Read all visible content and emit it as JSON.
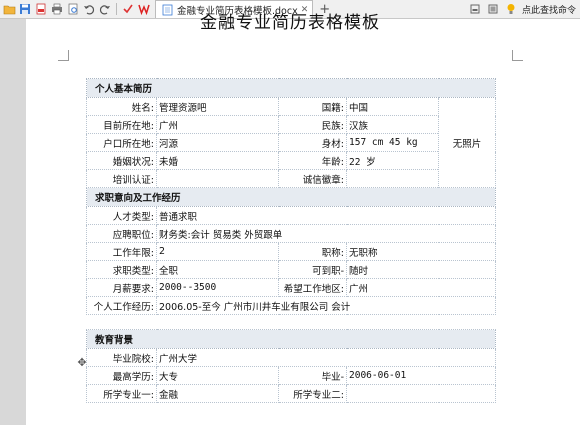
{
  "toolbar": {
    "icons": [
      "open-icon",
      "save-icon",
      "pdf-icon",
      "print-icon",
      "preview-icon",
      "undo-icon",
      "redo-icon",
      "check-icon",
      "wps-icon"
    ],
    "tab_label": "金融专业简历表格模板.docx",
    "right_command": "点此查找命令"
  },
  "document": {
    "title": "金融专业简历表格模板",
    "sections": {
      "basic": "个人基本简历",
      "intent": "求职意向及工作经历",
      "education": "教育背景"
    },
    "basic": {
      "name_label": "姓名:",
      "name_value": "管理资源吧",
      "nationality_label": "国籍:",
      "nationality_value": "中国",
      "location_label": "目前所在地:",
      "location_value": "广州",
      "ethnicity_label": "民族:",
      "ethnicity_value": "汉族",
      "hukou_label": "户口所在地:",
      "hukou_value": "河源",
      "stature_label": "身材:",
      "stature_value": "157 cm  45 kg",
      "marital_label": "婚姻状况:",
      "marital_value": "未婚",
      "age_label": "年龄:",
      "age_value": "22 岁",
      "training_label": "培训认证:",
      "training_value": "",
      "credit_label": "诚信徽章:",
      "credit_value": "",
      "photo": "无照片"
    },
    "intent": {
      "talent_label": "人才类型:",
      "talent_value": "普通求职",
      "position_label": "应聘职位:",
      "position_value": "财务类:会计     贸易类 外贸跟单",
      "years_label": "工作年限:",
      "years_value": "2",
      "title_label": "职称:",
      "title_value": "无职称",
      "type_label": "求职类型:",
      "type_value": "全职",
      "onboard_label": "可到职-",
      "onboard_value": "随时",
      "salary_label": "月薪要求:",
      "salary_value": "2000--3500",
      "region_label": "希望工作地区:",
      "region_value": "广州",
      "experience_label": "个人工作经历:",
      "experience_value": "2006.05-至今    广州市川井车业有限公司      会计"
    },
    "education": {
      "school_label": "毕业院校:",
      "school_value": "广州大学",
      "degree_label": "最高学历:",
      "degree_value": "大专",
      "graduation_label": "毕业-",
      "graduation_value": "2006-06-01",
      "major1_label": "所学专业一:",
      "major1_value": "金融",
      "major2_label": "所学专业二:",
      "major2_value": ""
    }
  }
}
